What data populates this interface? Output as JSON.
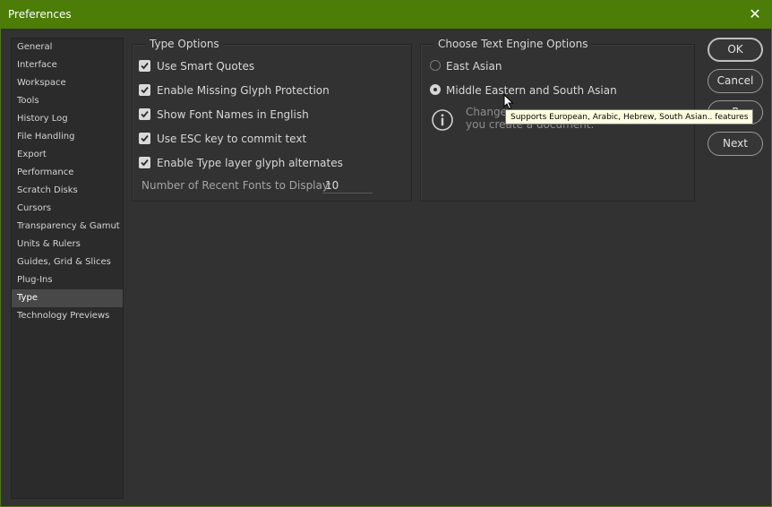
{
  "window": {
    "title": "Preferences",
    "close_label": "✕",
    "accent_color": "#4b7d07"
  },
  "sidebar": {
    "items": [
      {
        "label": "General"
      },
      {
        "label": "Interface"
      },
      {
        "label": "Workspace"
      },
      {
        "label": "Tools"
      },
      {
        "label": "History Log"
      },
      {
        "label": "File Handling"
      },
      {
        "label": "Export"
      },
      {
        "label": "Performance"
      },
      {
        "label": "Scratch Disks"
      },
      {
        "label": "Cursors"
      },
      {
        "label": "Transparency & Gamut"
      },
      {
        "label": "Units & Rulers"
      },
      {
        "label": "Guides, Grid & Slices"
      },
      {
        "label": "Plug-Ins"
      },
      {
        "label": "Type",
        "selected": true
      },
      {
        "label": "Technology Previews"
      }
    ]
  },
  "type_options": {
    "legend": "Type Options",
    "options": [
      {
        "label": "Use Smart Quotes",
        "checked": true
      },
      {
        "label": "Enable Missing Glyph Protection",
        "checked": true
      },
      {
        "label": "Show Font Names in English",
        "checked": true
      },
      {
        "label": "Use ESC key to commit text",
        "checked": true
      },
      {
        "label": "Enable Type layer glyph alternates",
        "checked": true
      }
    ],
    "recent_fonts_label": "Number of Recent Fonts to Display:",
    "recent_fonts_value": "10"
  },
  "text_engine": {
    "legend": "Choose Text Engine Options",
    "options": [
      {
        "label": "East Asian",
        "selected": false
      },
      {
        "label": "Middle Eastern and South Asian",
        "selected": true
      }
    ],
    "note_line1": "Change",
    "note_line2": "you create a document.",
    "info_icon": "info-icon"
  },
  "buttons": {
    "ok": "OK",
    "cancel": "Cancel",
    "prev": "P",
    "next": "Next"
  },
  "tooltip": "Supports European, Arabic, Hebrew, South Asian.. features"
}
